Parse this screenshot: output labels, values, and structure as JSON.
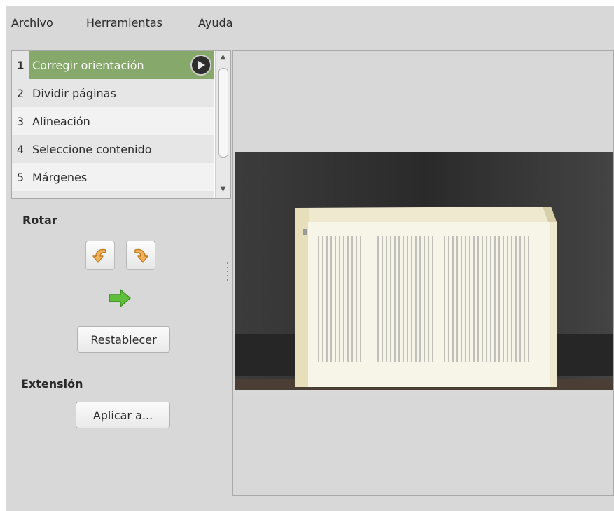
{
  "menu": {
    "items": [
      "Archivo",
      "Herramientas",
      "Ayuda"
    ]
  },
  "stages": [
    {
      "num": "1",
      "label": "Corregir orientación",
      "selected": true
    },
    {
      "num": "2",
      "label": "Dividir páginas"
    },
    {
      "num": "3",
      "label": "Alineación"
    },
    {
      "num": "4",
      "label": "Seleccione contenido"
    },
    {
      "num": "5",
      "label": "Márgenes"
    }
  ],
  "rotate": {
    "title": "Rotar",
    "reset_label": "Restablecer"
  },
  "scope": {
    "title": "Extensión",
    "apply_label": "Aplicar a..."
  },
  "icons": {
    "go": "play-icon",
    "rotate_left": "rotate-left-icon",
    "rotate_right": "rotate-right-icon",
    "orientation": "green-arrow-right-icon"
  },
  "colors": {
    "selected_row": "#86a96b",
    "window_bg": "#d8d8d8"
  }
}
